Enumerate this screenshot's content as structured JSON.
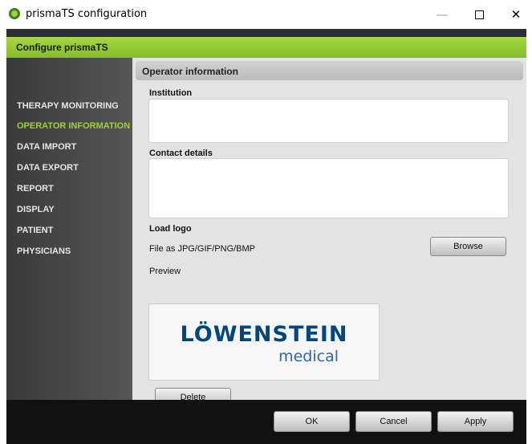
{
  "window": {
    "title": "prismaTS configuration",
    "minimize": "—",
    "close": "✕",
    "app_icon": "prisma-app-icon"
  },
  "header": {
    "title": "Configure prismaTS"
  },
  "colors": {
    "accent_green": "#9ed23a",
    "logo_blue": "#00467f"
  },
  "sidebar": {
    "items": [
      {
        "label": "THERAPY MONITORING",
        "active": false
      },
      {
        "label": "OPERATOR INFORMATION",
        "active": true
      },
      {
        "label": "DATA IMPORT",
        "active": false
      },
      {
        "label": "DATA EXPORT",
        "active": false
      },
      {
        "label": "REPORT",
        "active": false
      },
      {
        "label": "DISPLAY",
        "active": false
      },
      {
        "label": "PATIENT",
        "active": false
      },
      {
        "label": "PHYSICIANS",
        "active": false
      }
    ]
  },
  "main": {
    "section_title": "Operator information",
    "institution_label": "Institution",
    "institution_value": "",
    "contact_label": "Contact details",
    "contact_value": "",
    "load_logo_label": "Load logo",
    "file_hint": "File as JPG/GIF/PNG/BMP",
    "browse_button": "Browse",
    "preview_label": "Preview",
    "logo_text_main": "LÖWENSTEIN",
    "logo_text_sub": "medical",
    "delete_button": "Delete"
  },
  "footer": {
    "ok_button": "OK",
    "cancel_button": "Cancel",
    "apply_button": "Apply"
  }
}
